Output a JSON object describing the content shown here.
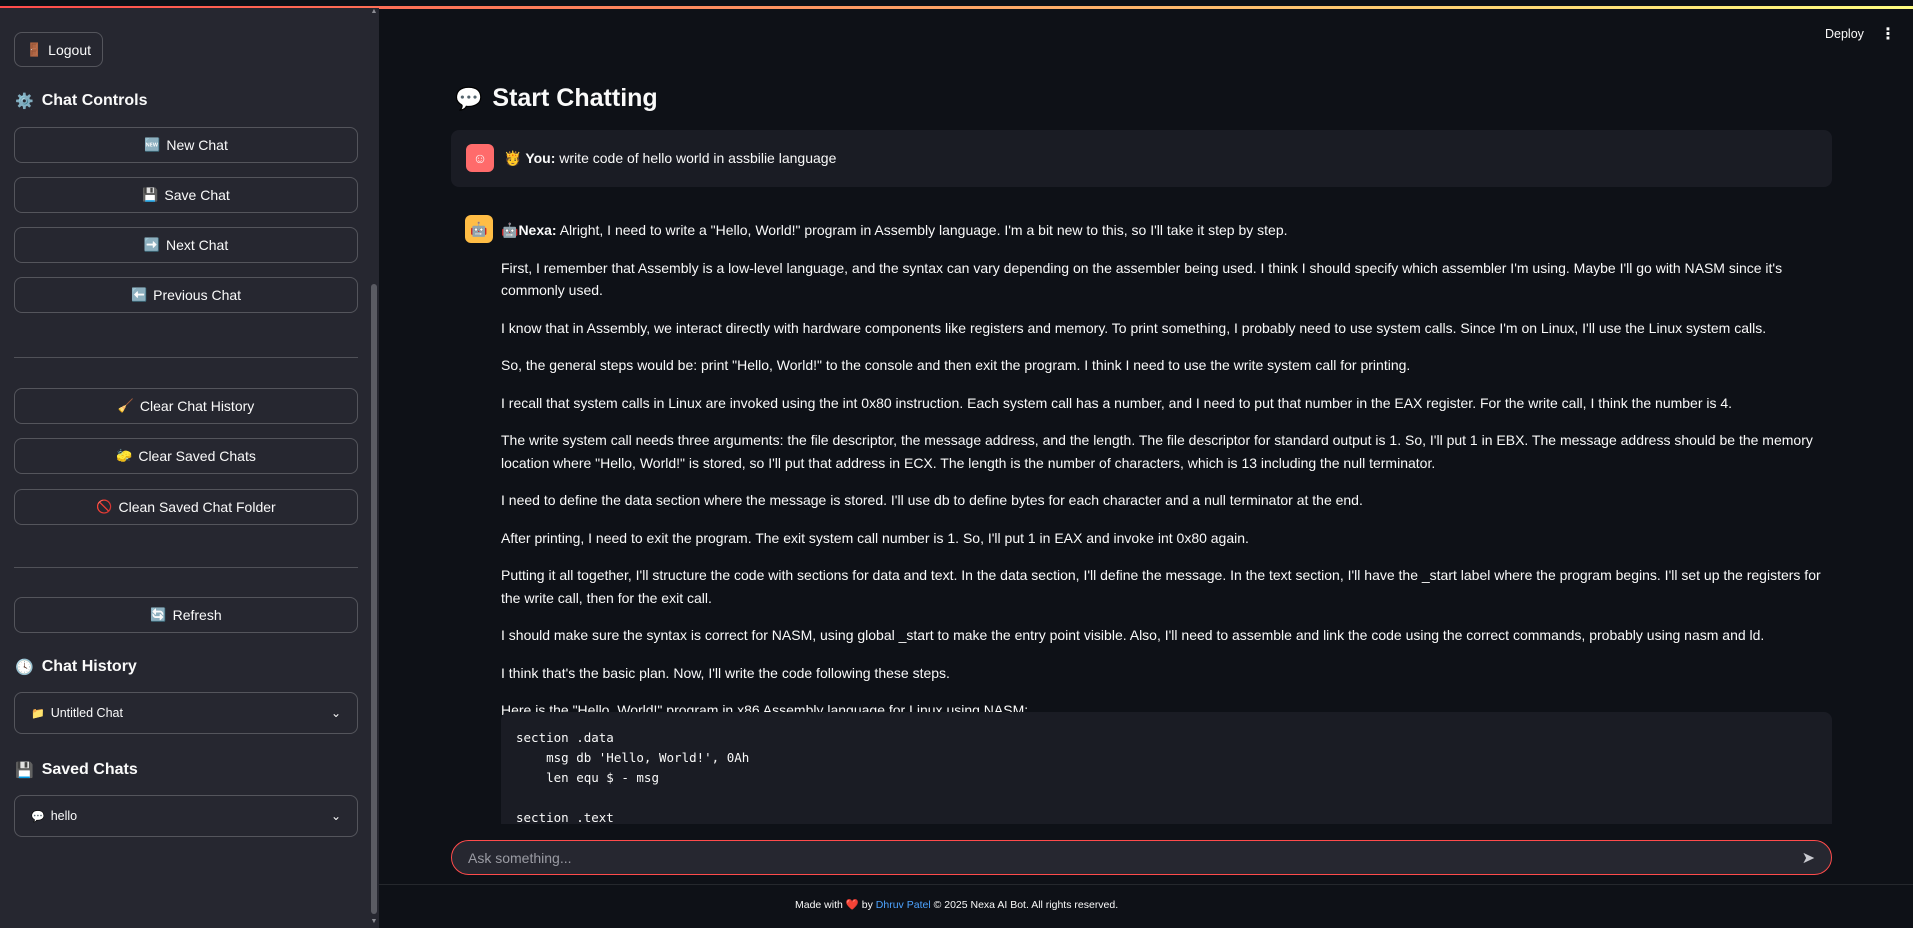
{
  "header": {
    "deploy_label": "Deploy",
    "menu_icon": "kebab-menu-icon"
  },
  "sidebar": {
    "logout": {
      "icon": "🚪",
      "label": "Logout"
    },
    "chat_controls": {
      "icon": "⚙️",
      "title": "Chat Controls"
    },
    "buttons": [
      {
        "icon": "🆕",
        "label": "New Chat"
      },
      {
        "icon": "💾",
        "label": "Save Chat"
      },
      {
        "icon": "➡️",
        "label": "Next Chat"
      },
      {
        "icon": "⬅️",
        "label": "Previous Chat"
      }
    ],
    "clear_buttons": [
      {
        "icon": "🧹",
        "label": "Clear Chat History"
      },
      {
        "icon": "🧽",
        "label": "Clear Saved Chats"
      },
      {
        "icon": "🚫",
        "label": "Clean Saved Chat Folder"
      }
    ],
    "refresh": {
      "icon": "🔄",
      "label": "Refresh"
    },
    "chat_history": {
      "icon": "🕓",
      "title": "Chat History",
      "selected_icon": "📁",
      "selected": "Untitled Chat"
    },
    "saved_chats": {
      "icon": "💾",
      "title": "Saved Chats",
      "selected_icon": "💬",
      "selected": "hello"
    }
  },
  "main": {
    "title_icon": "💬",
    "title": "Start Chatting",
    "user_message": {
      "prefix_icon": "🫅",
      "author": "You:",
      "text": "write code of hello world in assbilie language"
    },
    "bot_message": {
      "author_icon": "🤖",
      "author": "Nexa:",
      "paragraphs": [
        "Alright, I need to write a \"Hello, World!\" program in Assembly language. I'm a bit new to this, so I'll take it step by step.",
        "First, I remember that Assembly is a low-level language, and the syntax can vary depending on the assembler being used. I think I should specify which assembler I'm using. Maybe I'll go with NASM since it's commonly used.",
        "I know that in Assembly, we interact directly with hardware components like registers and memory. To print something, I probably need to use system calls. Since I'm on Linux, I'll use the Linux system calls.",
        "So, the general steps would be: print \"Hello, World!\" to the console and then exit the program. I think I need to use the write system call for printing.",
        "I recall that system calls in Linux are invoked using the int 0x80 instruction. Each system call has a number, and I need to put that number in the EAX register. For the write call, I think the number is 4.",
        "The write system call needs three arguments: the file descriptor, the message address, and the length. The file descriptor for standard output is 1. So, I'll put 1 in EBX. The message address should be the memory location where \"Hello, World!\" is stored, so I'll put that address in ECX. The length is the number of characters, which is 13 including the null terminator.",
        "I need to define the data section where the message is stored. I'll use db to define bytes for each character and a null terminator at the end.",
        "After printing, I need to exit the program. The exit system call number is 1. So, I'll put 1 in EAX and invoke int 0x80 again.",
        "Putting it all together, I'll structure the code with sections for data and text. In the data section, I'll define the message. In the text section, I'll have the _start label where the program begins. I'll set up the registers for the write call, then for the exit call.",
        "I should make sure the syntax is correct for NASM, using global _start to make the entry point visible. Also, I'll need to assemble and link the code using the correct commands, probably using nasm and ld.",
        "I think that's the basic plan. Now, I'll write the code following these steps.",
        "Here is the \"Hello, World!\" program in x86 Assembly language for Linux using NASM:"
      ],
      "code": "section .data\n    msg db 'Hello, World!', 0Ah\n    len equ $ - msg\n\nsection .text"
    },
    "input": {
      "placeholder": "Ask something..."
    }
  },
  "footer": {
    "made_with": "Made with",
    "heart": "❤️",
    "by": "by",
    "author": "Dhruv Patel",
    "rest": "© 2025 Nexa AI Bot. All rights reserved."
  },
  "colors": {
    "accent": "#ff4b4b",
    "bg": "#0e1117",
    "sidebar": "#262730",
    "link": "#4da3ff"
  }
}
